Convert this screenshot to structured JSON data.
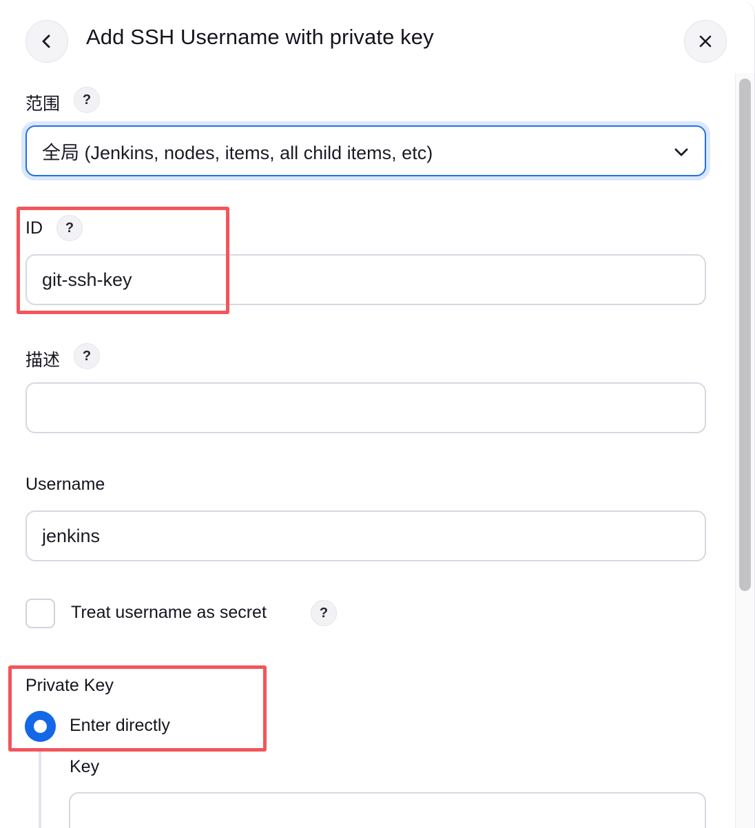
{
  "dialog": {
    "title": "Add SSH Username with private key",
    "back_icon": "chevron-left-icon",
    "close_icon": "close-icon"
  },
  "scope": {
    "label": "范围",
    "help": "?",
    "selected": "全局 (Jenkins, nodes, items, all child items, etc)"
  },
  "id_field": {
    "label": "ID",
    "help": "?",
    "value": "git-ssh-key"
  },
  "description": {
    "label": "描述",
    "help": "?",
    "value": ""
  },
  "username": {
    "label": "Username",
    "value": "jenkins"
  },
  "treat_secret": {
    "label": "Treat username as secret",
    "help": "?",
    "checked": false
  },
  "private_key": {
    "label": "Private Key",
    "option_label": "Enter directly",
    "selected": true,
    "key_label": "Key",
    "key_value": ""
  },
  "colors": {
    "accent": "#1268e6",
    "highlight_box": "#f2555a"
  }
}
